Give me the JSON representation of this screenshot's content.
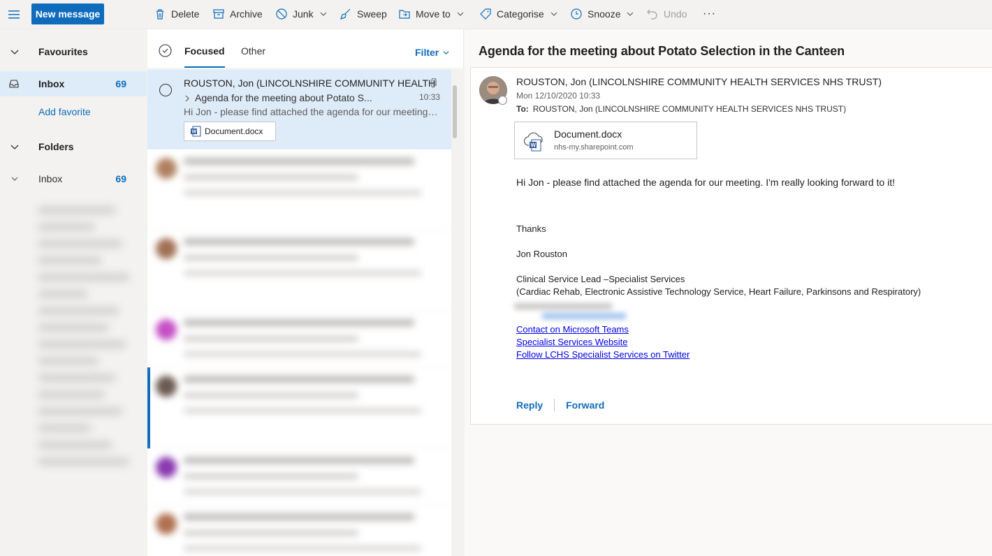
{
  "toolbar": {
    "new_message": "New message",
    "delete": "Delete",
    "archive": "Archive",
    "junk": "Junk",
    "sweep": "Sweep",
    "move_to": "Move to",
    "categorise": "Categorise",
    "snooze": "Snooze",
    "undo": "Undo",
    "more": "···"
  },
  "nav": {
    "favourites": "Favourites",
    "fav_inbox": {
      "label": "Inbox",
      "count": "69"
    },
    "add_favorite": "Add favorite",
    "folders": "Folders",
    "folder_inbox": {
      "label": "Inbox",
      "count": "69"
    }
  },
  "list": {
    "tab_focused": "Focused",
    "tab_other": "Other",
    "filter": "Filter",
    "selected": {
      "from": "ROUSTON, Jon (LINCOLNSHIRE COMMUNITY HEALTH",
      "subject": "Agenda for the meeting about Potato S...",
      "time": "10:33",
      "preview": "Hi Jon - please find attached the agenda for our meeting. I'm really looking forward to it!",
      "attachment": "Document.docx"
    }
  },
  "reading": {
    "title": "Agenda for the meeting about Potato Selection in the Canteen",
    "sender": "ROUSTON, Jon (LINCOLNSHIRE COMMUNITY HEALTH SERVICES NHS TRUST)",
    "date": "Mon 12/10/2020 10:33",
    "to_label": "To:",
    "to": "ROUSTON, Jon (LINCOLNSHIRE COMMUNITY HEALTH SERVICES NHS TRUST)",
    "file_name": "Document.docx",
    "file_source": "nhs-my.sharepoint.com",
    "body": "Hi Jon - please find attached the agenda for our meeting. I'm really looking forward to it!",
    "thanks": "Thanks",
    "signature_name": "Jon Rouston",
    "signature_role": "Clinical Service Lead –Specialist Services",
    "signature_dept": "(Cardiac Rehab, Electronic Assistive Technology Service, Heart Failure, Parkinsons and Respiratory)",
    "link_teams": "Contact on Microsoft Teams",
    "link_website": "Specialist Services Website",
    "link_twitter": "Follow LCHS Specialist Services on Twitter",
    "reply": "Reply",
    "forward": "Forward"
  },
  "colors": {
    "accent": "#0f6cbd",
    "selected_bg": "#deecf9"
  }
}
